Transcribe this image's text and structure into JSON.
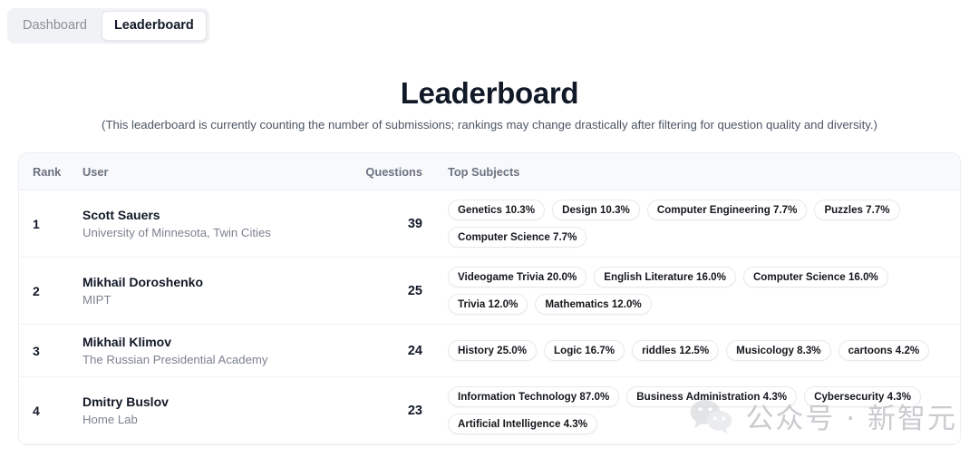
{
  "tabs": [
    {
      "label": "Dashboard",
      "active": false
    },
    {
      "label": "Leaderboard",
      "active": true
    }
  ],
  "header": {
    "title": "Leaderboard",
    "subtitle": "(This leaderboard is currently counting the number of submissions; rankings may change drastically after filtering for question quality and diversity.)"
  },
  "table": {
    "columns": {
      "rank": "Rank",
      "user": "User",
      "questions": "Questions",
      "subjects": "Top Subjects"
    },
    "rows": [
      {
        "rank": "1",
        "name": "Scott Sauers",
        "affiliation": "University of Minnesota, Twin Cities",
        "questions": "39",
        "subjects": [
          "Genetics 10.3%",
          "Design 10.3%",
          "Computer Engineering 7.7%",
          "Puzzles 7.7%",
          "Computer Science 7.7%"
        ]
      },
      {
        "rank": "2",
        "name": "Mikhail Doroshenko",
        "affiliation": "MIPT",
        "questions": "25",
        "subjects": [
          "Videogame Trivia 20.0%",
          "English Literature 16.0%",
          "Computer Science 16.0%",
          "Trivia 12.0%",
          "Mathematics 12.0%"
        ]
      },
      {
        "rank": "3",
        "name": "Mikhail Klimov",
        "affiliation": "The Russian Presidential Academy",
        "questions": "24",
        "subjects": [
          "History 25.0%",
          "Logic 16.7%",
          "riddles 12.5%",
          "Musicology 8.3%",
          "cartoons 4.2%"
        ]
      },
      {
        "rank": "4",
        "name": "Dmitry Buslov",
        "affiliation": "Home Lab",
        "questions": "23",
        "subjects": [
          "Information Technology 87.0%",
          "Business Administration 4.3%",
          "Cybersecurity 4.3%",
          "Artificial Intelligence 4.3%"
        ]
      }
    ]
  },
  "watermark": {
    "icon": "wechat-logo-icon",
    "text": "公众号 · 新智元"
  },
  "colors": {
    "page_bg": "#ffffff",
    "tabbar_bg": "#f1f2f5",
    "table_header_bg": "#f8f9fb",
    "text_primary": "#111827",
    "text_muted": "#7c828e",
    "border": "#eceef1",
    "watermark": "#c9cbcf"
  }
}
